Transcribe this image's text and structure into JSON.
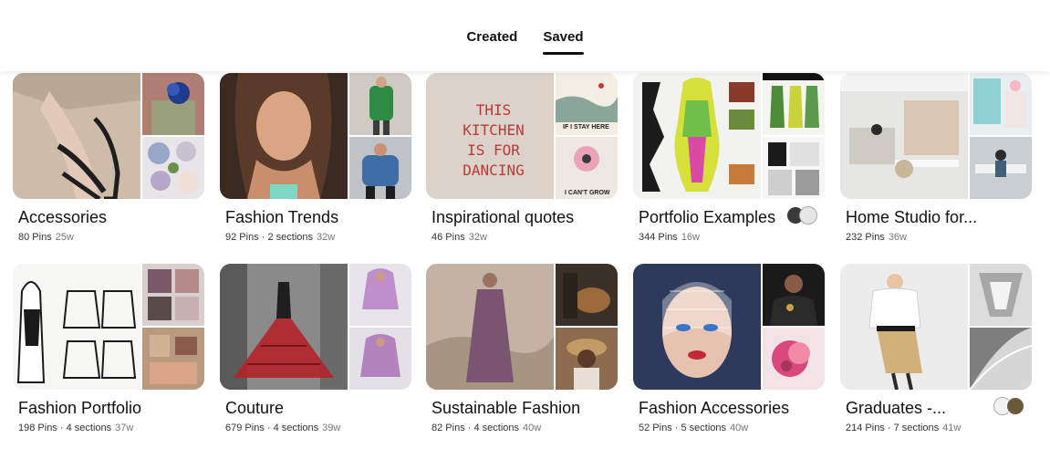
{
  "tabs": [
    {
      "label": "Created",
      "active": false
    },
    {
      "label": "Saved",
      "active": true
    }
  ],
  "boards": [
    {
      "title": "Accessories",
      "pins": "80 Pins",
      "sections": "",
      "ago": "25w",
      "colors": [
        "#c9b7a6",
        "#3a2a2a",
        "#8f7f6e",
        "#6e8fbe",
        "#b9b2c4"
      ]
    },
    {
      "title": "Fashion Trends",
      "pins": "92 Pins",
      "sections": "2 sections",
      "ago": "32w",
      "colors": [
        "#6e4b3a",
        "#2f7a3e",
        "#3d5d8a"
      ]
    },
    {
      "title": "Inspirational quotes",
      "pins": "46 Pins",
      "sections": "",
      "ago": "32w",
      "quote": "THIS KITCHEN IS FOR DANCING",
      "top_note": "IF I STAY HERE",
      "bottom_note": "I CAN'T GROW",
      "colors": [
        "#dcd0c6",
        "#f1ebe0",
        "#e9e5de"
      ]
    },
    {
      "title": "Portfolio Examples",
      "pins": "344 Pins",
      "sections": "",
      "ago": "16w",
      "colors": [
        "#f2f2ee",
        "#d8cf5a",
        "#5b8a3c"
      ]
    },
    {
      "title": "Home Studio for...",
      "pins": "232 Pins",
      "sections": "",
      "ago": "36w",
      "colors": [
        "#e6e6e4",
        "#d9c9b7",
        "#b9b3a8"
      ]
    },
    {
      "title": "Fashion Portfolio",
      "pins": "198 Pins",
      "sections": "4 sections",
      "ago": "37w",
      "colors": [
        "#f4f4f2",
        "#8a6a6a",
        "#a17b60"
      ]
    },
    {
      "title": "Couture",
      "pins": "679 Pins",
      "sections": "4 sections",
      "ago": "39w",
      "colors": [
        "#7a7a7a",
        "#c9a2c9",
        "#b28ab6"
      ]
    },
    {
      "title": "Sustainable Fashion",
      "pins": "82 Pins",
      "sections": "4 sections",
      "ago": "40w",
      "colors": [
        "#b7a294",
        "#9a6a3b",
        "#6b5038"
      ]
    },
    {
      "title": "Fashion Accessories",
      "pins": "52 Pins",
      "sections": "5 sections",
      "ago": "40w",
      "colors": [
        "#2d3a5c",
        "#1a1a1a",
        "#d96a8c"
      ]
    },
    {
      "title": "Graduates -...",
      "pins": "214 Pins",
      "sections": "7 sections",
      "ago": "41w",
      "colors": [
        "#e8e8e8",
        "#8c8c8c",
        "#b3b3b3"
      ]
    }
  ]
}
